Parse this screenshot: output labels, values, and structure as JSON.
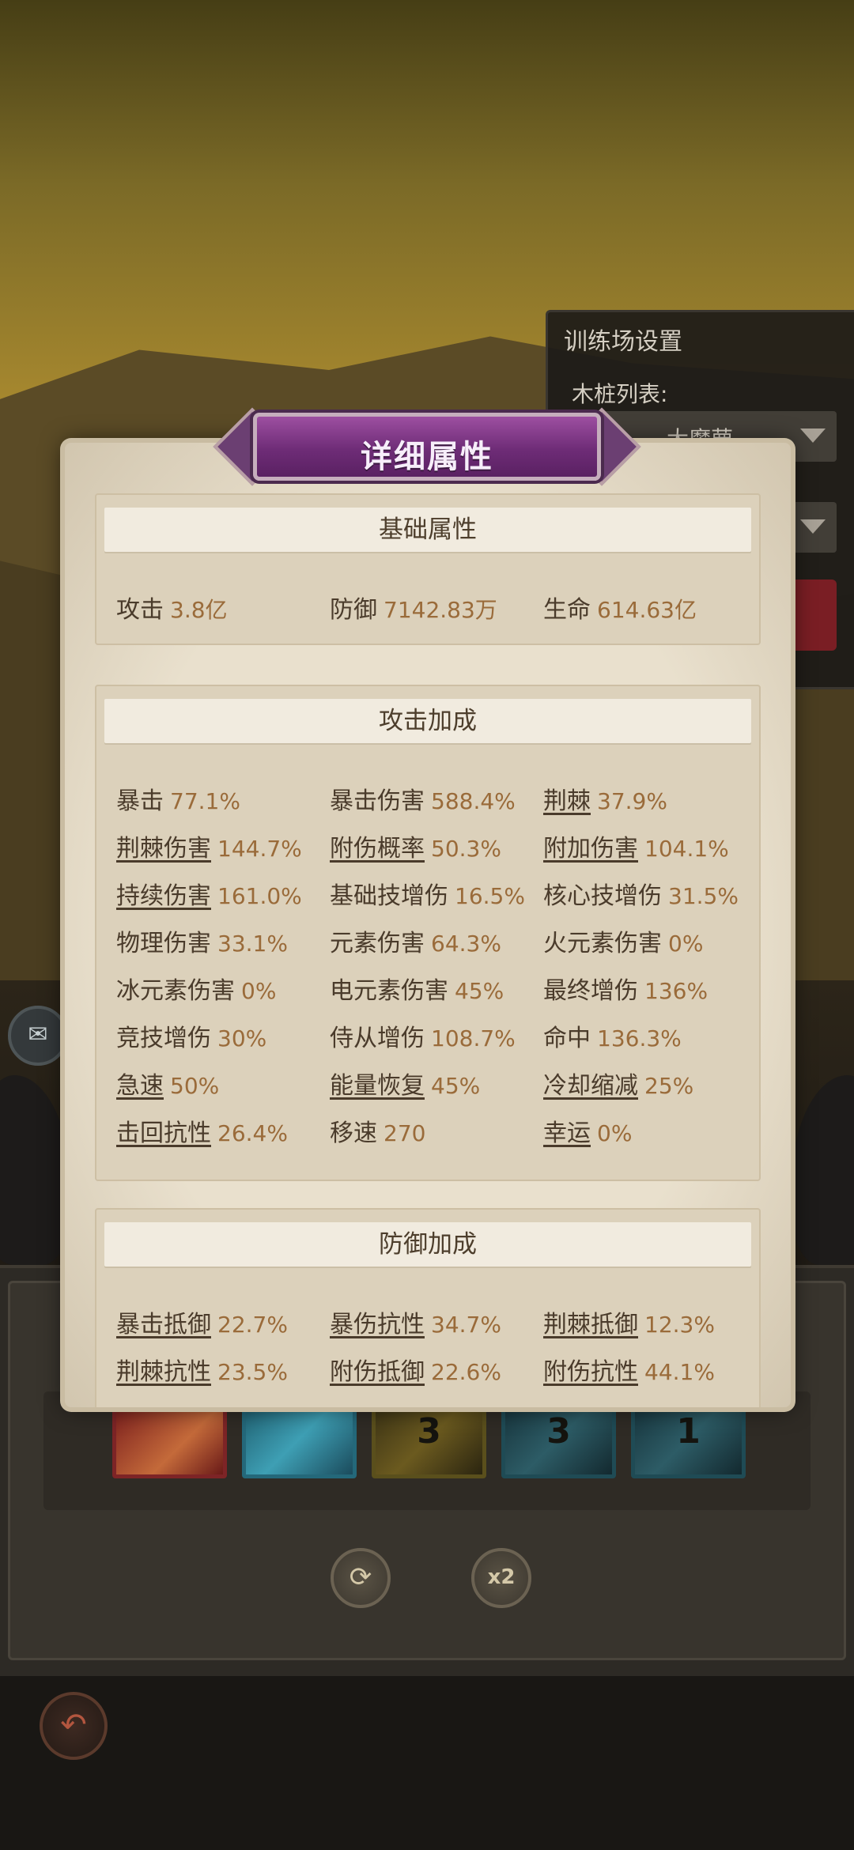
{
  "training_panel": {
    "title": "训练场设置",
    "dummy_label": "木桩列表:",
    "dummy_value": "大魔萝"
  },
  "modal": {
    "title": "详细属性",
    "sections": [
      {
        "title": "基础属性",
        "stats": [
          {
            "name": "攻击",
            "value": "3.8亿",
            "link": false
          },
          {
            "name": "防御",
            "value": "7142.83万",
            "link": false
          },
          {
            "name": "生命",
            "value": "614.63亿",
            "link": false
          }
        ]
      },
      {
        "title": "攻击加成",
        "stats": [
          {
            "name": "暴击",
            "value": "77.1%",
            "link": false
          },
          {
            "name": "暴击伤害",
            "value": "588.4%",
            "link": false
          },
          {
            "name": "荆棘",
            "value": "37.9%",
            "link": true
          },
          {
            "name": "荆棘伤害",
            "value": "144.7%",
            "link": true
          },
          {
            "name": "附伤概率",
            "value": "50.3%",
            "link": true
          },
          {
            "name": "附加伤害",
            "value": "104.1%",
            "link": true
          },
          {
            "name": "持续伤害",
            "value": "161.0%",
            "link": true
          },
          {
            "name": "基础技增伤",
            "value": "16.5%",
            "link": false
          },
          {
            "name": "核心技增伤",
            "value": "31.5%",
            "link": false
          },
          {
            "name": "物理伤害",
            "value": "33.1%",
            "link": false
          },
          {
            "name": "元素伤害",
            "value": "64.3%",
            "link": false
          },
          {
            "name": "火元素伤害",
            "value": "0%",
            "link": false
          },
          {
            "name": "冰元素伤害",
            "value": "0%",
            "link": false
          },
          {
            "name": "电元素伤害",
            "value": "45%",
            "link": false
          },
          {
            "name": "最终增伤",
            "value": "136%",
            "link": false
          },
          {
            "name": "竞技增伤",
            "value": "30%",
            "link": false
          },
          {
            "name": "侍从增伤",
            "value": "108.7%",
            "link": false
          },
          {
            "name": "命中",
            "value": "136.3%",
            "link": false
          },
          {
            "name": "急速",
            "value": "50%",
            "link": true
          },
          {
            "name": "能量恢复",
            "value": "45%",
            "link": true
          },
          {
            "name": "冷却缩减",
            "value": "25%",
            "link": true
          },
          {
            "name": "击回抗性",
            "value": "26.4%",
            "link": true
          },
          {
            "name": "移速",
            "value": "270",
            "link": false
          },
          {
            "name": "幸运",
            "value": "0%",
            "link": true
          }
        ]
      },
      {
        "title": "防御加成",
        "stats": [
          {
            "name": "暴击抵御",
            "value": "22.7%",
            "link": true
          },
          {
            "name": "暴伤抗性",
            "value": "34.7%",
            "link": true
          },
          {
            "name": "荆棘抵御",
            "value": "12.3%",
            "link": true
          },
          {
            "name": "荆棘抗性",
            "value": "23.5%",
            "link": true
          },
          {
            "name": "附伤抵御",
            "value": "22.6%",
            "link": true
          },
          {
            "name": "附伤抗性",
            "value": "44.1%",
            "link": true
          }
        ]
      }
    ]
  },
  "skill_cards": [
    {
      "level": ""
    },
    {
      "level": ""
    },
    {
      "level": "3"
    },
    {
      "level": "3"
    },
    {
      "level": "1"
    }
  ],
  "buttons": {
    "speed_label": "x2",
    "back_icon": "back-arrow-icon",
    "refresh_icon": "refresh-icon",
    "chat_icon": "chat-icon"
  }
}
